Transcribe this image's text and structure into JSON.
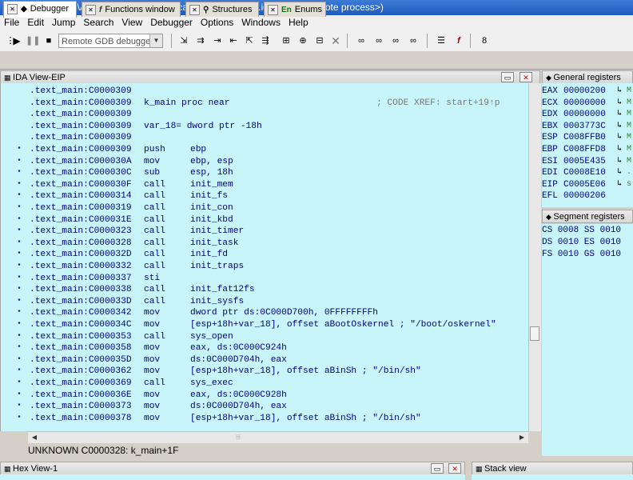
{
  "window": {
    "title": "IDA - C:\\Users\\ADMINI~1\\AppData\\Local\\Temp\\ida27605.idb (<GDB remote process>)"
  },
  "menu": [
    "File",
    "Edit",
    "Jump",
    "Search",
    "View",
    "Debugger",
    "Options",
    "Windows",
    "Help"
  ],
  "toolbar": {
    "debugger_select": "Remote GDB debugger"
  },
  "tabs": [
    {
      "label": "Debugger",
      "icon": "diamond-icon"
    },
    {
      "label": "Functions window",
      "icon": "function-icon"
    },
    {
      "label": "Structures",
      "icon": "structure-icon"
    },
    {
      "label": "Enums",
      "icon": "En"
    }
  ],
  "ida_view": {
    "title": "IDA View-EIP",
    "lines": [
      {
        "addr": ".text_main:C0000309",
        "op": "",
        "args": "",
        "label": "",
        "xref": "",
        "dot": false
      },
      {
        "addr": ".text_main:C0000309",
        "op": "",
        "args": "",
        "label": "k_main proc near",
        "xref": "; CODE XREF: start+19↑p",
        "dot": false
      },
      {
        "addr": ".text_main:C0000309",
        "op": "",
        "args": "",
        "label": "",
        "xref": "",
        "dot": false
      },
      {
        "addr": ".text_main:C0000309",
        "op": "",
        "args": "",
        "label": "var_18= dword ptr -18h",
        "xref": "",
        "dot": false
      },
      {
        "addr": ".text_main:C0000309",
        "op": "",
        "args": "",
        "label": "",
        "xref": "",
        "dot": false
      },
      {
        "addr": ".text_main:C0000309",
        "op": "push",
        "args": "ebp",
        "label": "",
        "xref": "",
        "dot": true
      },
      {
        "addr": ".text_main:C000030A",
        "op": "mov",
        "args": "ebp, esp",
        "label": "",
        "xref": "",
        "dot": true
      },
      {
        "addr": ".text_main:C000030C",
        "op": "sub",
        "args": "esp, 18h",
        "label": "",
        "xref": "",
        "dot": true
      },
      {
        "addr": ".text_main:C000030F",
        "op": "call",
        "args": "init_mem",
        "label": "",
        "xref": "",
        "dot": true
      },
      {
        "addr": ".text_main:C0000314",
        "op": "call",
        "args": "init_fs",
        "label": "",
        "xref": "",
        "dot": true
      },
      {
        "addr": ".text_main:C0000319",
        "op": "call",
        "args": "init_con",
        "label": "",
        "xref": "",
        "dot": true
      },
      {
        "addr": ".text_main:C000031E",
        "op": "call",
        "args": "init_kbd",
        "label": "",
        "xref": "",
        "dot": true
      },
      {
        "addr": ".text_main:C0000323",
        "op": "call",
        "args": "init_timer",
        "label": "",
        "xref": "",
        "dot": true
      },
      {
        "addr": ".text_main:C0000328",
        "op": "call",
        "args": "init_task",
        "label": "",
        "xref": "",
        "dot": true
      },
      {
        "addr": ".text_main:C000032D",
        "op": "call",
        "args": "init_fd",
        "label": "",
        "xref": "",
        "dot": true
      },
      {
        "addr": ".text_main:C0000332",
        "op": "call",
        "args": "init_traps",
        "label": "",
        "xref": "",
        "dot": true
      },
      {
        "addr": ".text_main:C0000337",
        "op": "sti",
        "args": "",
        "label": "",
        "xref": "",
        "dot": true
      },
      {
        "addr": ".text_main:C0000338",
        "op": "call",
        "args": "init_fat12fs",
        "label": "",
        "xref": "",
        "dot": true
      },
      {
        "addr": ".text_main:C000033D",
        "op": "call",
        "args": "init_sysfs",
        "label": "",
        "xref": "",
        "dot": true
      },
      {
        "addr": ".text_main:C0000342",
        "op": "mov",
        "args": "dword ptr ds:0C000D700h, 0FFFFFFFFh",
        "label": "",
        "xref": "",
        "dot": true
      },
      {
        "addr": ".text_main:C000034C",
        "op": "mov",
        "args": "[esp+18h+var_18], offset aBootOskernel ; \"/boot/oskernel\"",
        "label": "",
        "xref": "",
        "dot": true
      },
      {
        "addr": ".text_main:C0000353",
        "op": "call",
        "args": "sys_open",
        "label": "",
        "xref": "",
        "dot": true
      },
      {
        "addr": ".text_main:C0000358",
        "op": "mov",
        "args": "eax, ds:0C000C924h",
        "label": "",
        "xref": "",
        "dot": true
      },
      {
        "addr": ".text_main:C000035D",
        "op": "mov",
        "args": "ds:0C000D704h, eax",
        "label": "",
        "xref": "",
        "dot": true
      },
      {
        "addr": ".text_main:C0000362",
        "op": "mov",
        "args": "[esp+18h+var_18], offset aBinSh ; \"/bin/sh\"",
        "label": "",
        "xref": "",
        "dot": true
      },
      {
        "addr": ".text_main:C0000369",
        "op": "call",
        "args": "sys_exec",
        "label": "",
        "xref": "",
        "dot": true
      },
      {
        "addr": ".text_main:C000036E",
        "op": "mov",
        "args": "eax, ds:0C000C928h",
        "label": "",
        "xref": "",
        "dot": true
      },
      {
        "addr": ".text_main:C0000373",
        "op": "mov",
        "args": "ds:0C000D704h, eax",
        "label": "",
        "xref": "",
        "dot": true
      },
      {
        "addr": ".text_main:C0000378",
        "op": "mov",
        "args": "[esp+18h+var_18], offset aBinSh ; \"/bin/sh\"",
        "label": "",
        "xref": "",
        "dot": true
      }
    ],
    "status": "UNKNOWN C0000328: k_main+1F"
  },
  "general_registers": {
    "title": "General registers",
    "regs": [
      {
        "name": "EAX",
        "value": "00000200",
        "mark": "M"
      },
      {
        "name": "ECX",
        "value": "00000000",
        "mark": "M"
      },
      {
        "name": "EDX",
        "value": "00000000",
        "mark": "M"
      },
      {
        "name": "EBX",
        "value": "0003773C",
        "mark": "M"
      },
      {
        "name": "ESP",
        "value": "C008FFB0",
        "mark": "M"
      },
      {
        "name": "EBP",
        "value": "C008FFD8",
        "mark": "M"
      },
      {
        "name": "ESI",
        "value": "0005E435",
        "mark": "M"
      },
      {
        "name": "EDI",
        "value": "C0008E10",
        "mark": "."
      },
      {
        "name": "EIP",
        "value": "C0005E06",
        "mark": "s"
      },
      {
        "name": "EFL",
        "value": "00000206",
        "mark": ""
      }
    ]
  },
  "segment_registers": {
    "title": "Segment registers",
    "rows": [
      "CS 0008 SS 0010",
      "DS 0010 ES 0010",
      "FS 0010 GS 0010"
    ]
  },
  "hex_view": {
    "title": "Hex View-1"
  },
  "stack_view": {
    "title": "Stack view"
  }
}
